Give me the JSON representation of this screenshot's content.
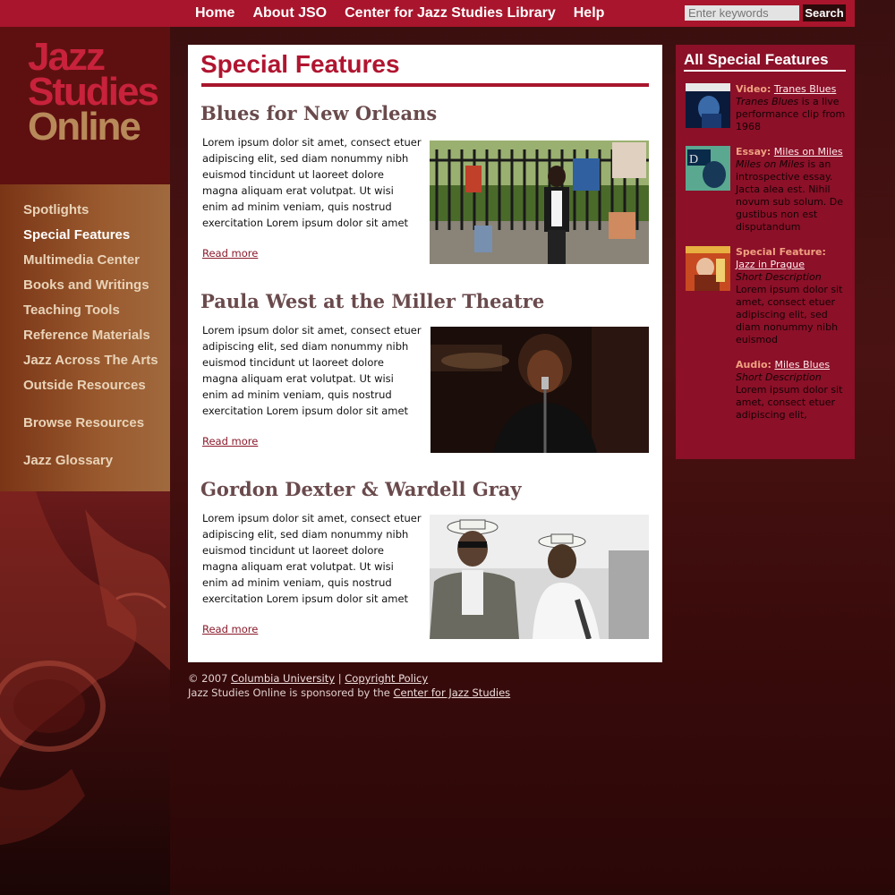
{
  "topnav": {
    "items": [
      "Home",
      "About JSO",
      "Center for Jazz Studies Library",
      "Help"
    ],
    "search_placeholder": "Enter keywords",
    "search_button": "Search"
  },
  "logo": {
    "line1": "Jazz",
    "line2": "Studies",
    "line3": "Online"
  },
  "leftnav": {
    "items": [
      "Spotlights",
      "Special Features",
      "Multimedia Center",
      "Books and Writings",
      "Teaching Tools",
      "Reference Materials",
      "Jazz Across The Arts",
      "Outside Resources",
      "Browse Resources",
      "Jazz Glossary"
    ],
    "active": "Special Features"
  },
  "main": {
    "title": "Special Features",
    "articles": [
      {
        "title": "Blues for New Orleans",
        "body": "Lorem ipsum dolor sit amet, consect etuer adipiscing elit, sed diam nonummy nibh euismod tincidunt ut laoreet dolore magna aliquam erat volutpat. Ut wisi enim ad minim veniam, quis nostrud exercitation Lorem ipsum dolor sit amet",
        "read_more": "Read more"
      },
      {
        "title": "Paula West at the Miller Theatre",
        "body": "Lorem ipsum dolor sit amet, consect etuer adipiscing elit, sed diam nonummy nibh euismod tincidunt ut laoreet dolore magna aliquam erat volutpat. Ut wisi enim ad minim veniam, quis nostrud exercitation Lorem ipsum dolor sit amet",
        "read_more": "Read more"
      },
      {
        "title": "Gordon Dexter & Wardell Gray",
        "body": "Lorem ipsum dolor sit amet, consect etuer adipiscing elit, sed diam nonummy nibh euismod tincidunt ut laoreet dolore magna aliquam erat volutpat. Ut wisi enim ad minim veniam, quis nostrud exercitation Lorem ipsum dolor sit amet",
        "read_more": "Read more"
      }
    ]
  },
  "sidebar": {
    "title": "All Special Features",
    "items": [
      {
        "type": "Video:",
        "link": "Tranes Blues",
        "desc_italic": "Tranes Blues",
        "desc": " is a live performance clip from 1968"
      },
      {
        "type": "Essay:",
        "link": "Miles on Miles",
        "desc_italic": "Miles on Miles",
        "desc": " is an introspective essay. Jacta alea est. Nihil novum sub solum. De gustibus non est disputandum"
      },
      {
        "type": "Special Feature:",
        "link": "Jazz in Prague",
        "desc_italic": "Short Description",
        "desc": "Lorem ipsum dolor sit amet, consect etuer adipiscing elit, sed diam nonummy nibh euismod"
      },
      {
        "type": "Audio:",
        "link": "Miles Blues",
        "desc_italic": "Short Description",
        "desc": "Lorem ipsum dolor sit amet, consect etuer adipiscing elit,"
      }
    ]
  },
  "footer": {
    "copyright": "© 2007",
    "university_link": "Columbia University",
    "separator": "|",
    "policy_link": "Copyright Policy",
    "sponsor_text": "Jazz Studies Online is sponsored by the",
    "sponsor_link": "Center for Jazz Studies"
  }
}
